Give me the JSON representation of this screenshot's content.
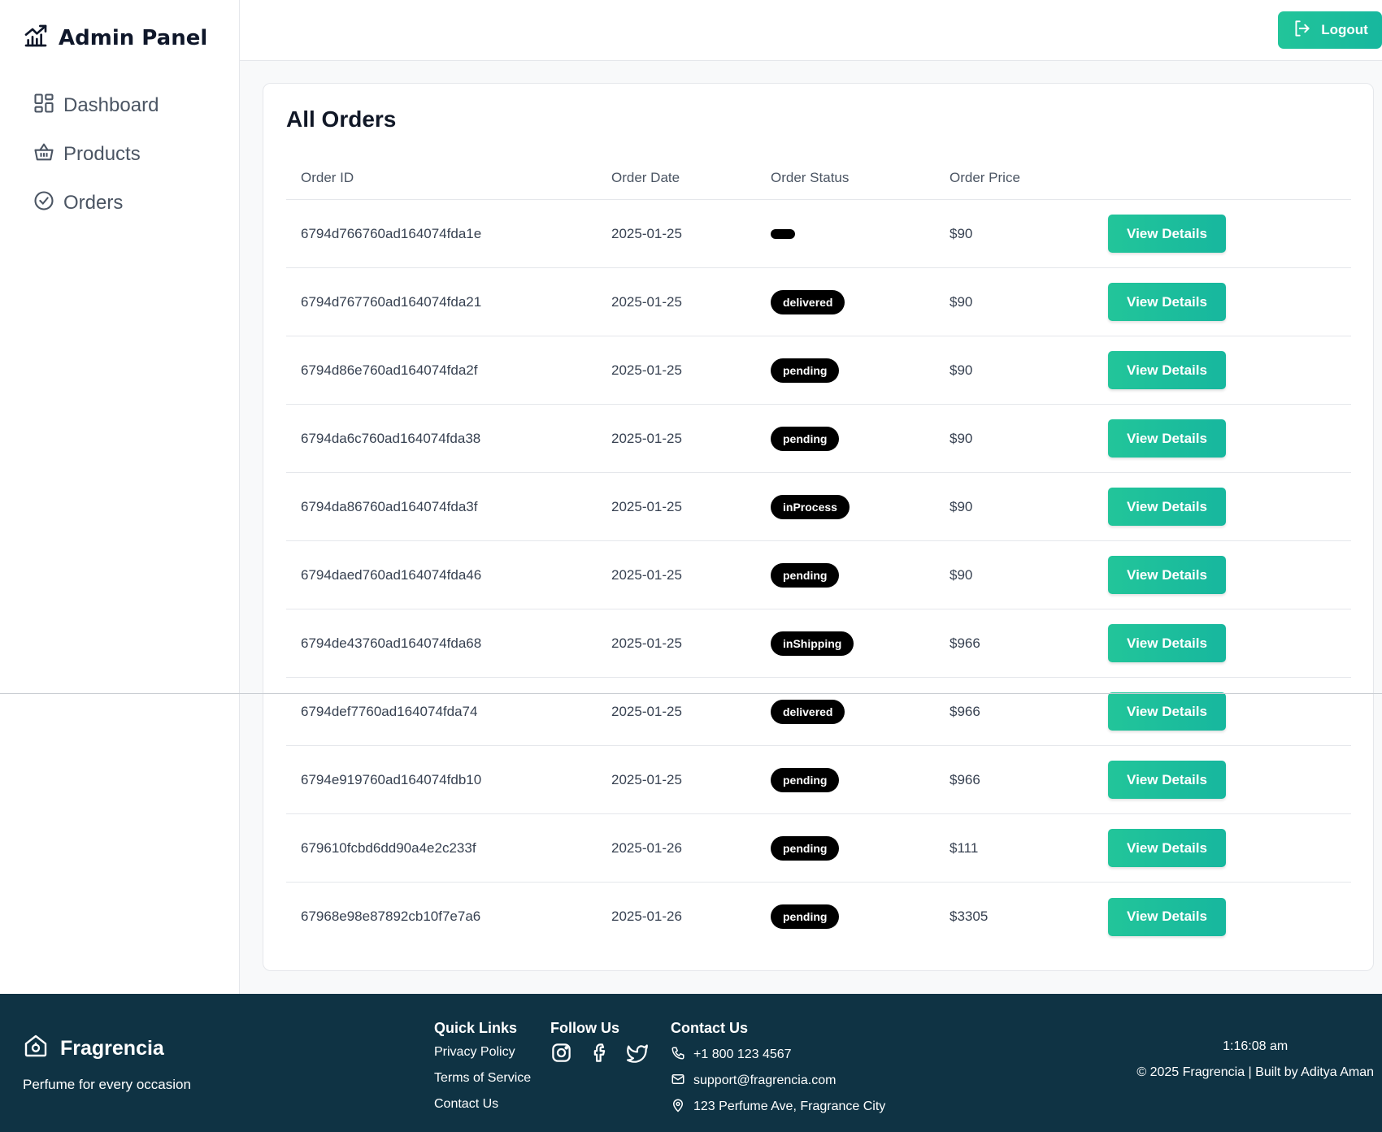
{
  "brand": {
    "title": "Admin Panel"
  },
  "sidebar": {
    "items": [
      {
        "label": "Dashboard",
        "icon": "dashboard-icon"
      },
      {
        "label": "Products",
        "icon": "basket-icon"
      },
      {
        "label": "Orders",
        "icon": "check-circle-icon"
      }
    ]
  },
  "topbar": {
    "logout_label": "Logout"
  },
  "orders": {
    "title": "All Orders",
    "columns": [
      "Order ID",
      "Order Date",
      "Order Status",
      "Order Price"
    ],
    "action_label": "View Details",
    "rows": [
      {
        "id": "6794d766760ad164074fda1e",
        "date": "2025-01-25",
        "status": "",
        "price": "$90"
      },
      {
        "id": "6794d767760ad164074fda21",
        "date": "2025-01-25",
        "status": "delivered",
        "price": "$90"
      },
      {
        "id": "6794d86e760ad164074fda2f",
        "date": "2025-01-25",
        "status": "pending",
        "price": "$90"
      },
      {
        "id": "6794da6c760ad164074fda38",
        "date": "2025-01-25",
        "status": "pending",
        "price": "$90"
      },
      {
        "id": "6794da86760ad164074fda3f",
        "date": "2025-01-25",
        "status": "inProcess",
        "price": "$90"
      },
      {
        "id": "6794daed760ad164074fda46",
        "date": "2025-01-25",
        "status": "pending",
        "price": "$90"
      },
      {
        "id": "6794de43760ad164074fda68",
        "date": "2025-01-25",
        "status": "inShipping",
        "price": "$966"
      },
      {
        "id": "6794def7760ad164074fda74",
        "date": "2025-01-25",
        "status": "delivered",
        "price": "$966"
      },
      {
        "id": "6794e919760ad164074fdb10",
        "date": "2025-01-25",
        "status": "pending",
        "price": "$966"
      },
      {
        "id": "679610fcbd6dd90a4e2c233f",
        "date": "2025-01-26",
        "status": "pending",
        "price": "$111"
      },
      {
        "id": "67968e98e87892cb10f7e7a6",
        "date": "2025-01-26",
        "status": "pending",
        "price": "$3305"
      }
    ]
  },
  "footer": {
    "brand": "Fragrencia",
    "tagline": "Perfume for every occasion",
    "quick_links": {
      "title": "Quick Links",
      "items": [
        "Privacy Policy",
        "Terms of Service",
        "Contact Us"
      ]
    },
    "follow": {
      "title": "Follow Us",
      "icons": [
        "instagram-icon",
        "facebook-icon",
        "twitter-icon"
      ]
    },
    "contact": {
      "title": "Contact Us",
      "phone": "+1 800 123 4567",
      "email": "support@fragrencia.com",
      "address": "123 Perfume Ave, Fragrance City"
    },
    "time": "1:16:08 am",
    "copyright": "© 2025 Fragrencia | Built by Aditya Aman"
  },
  "colors": {
    "accent": "#1fc19c",
    "footer_bg": "#0f3344",
    "badge_bg": "#000000"
  }
}
